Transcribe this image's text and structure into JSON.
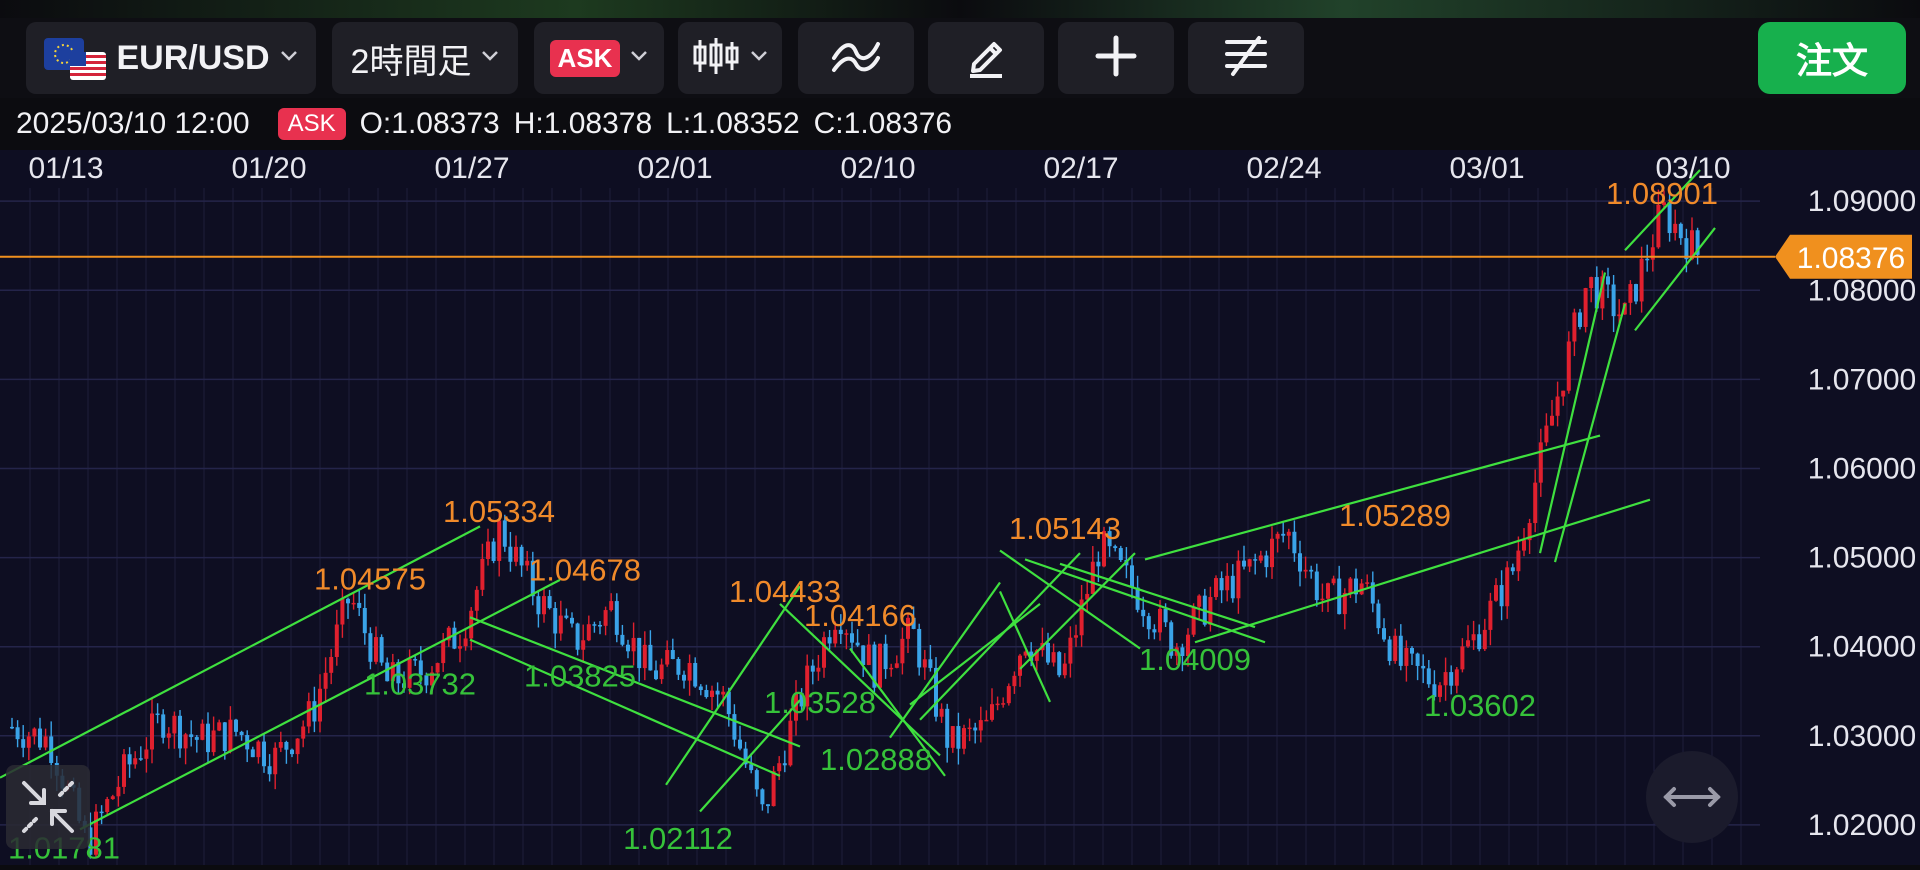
{
  "colors": {
    "ask": "#e8314f",
    "order": "#17b04d",
    "bull": "#e0202e",
    "bear": "#3aa3e8",
    "trendline": "#3fe03f",
    "high_label": "#f08a2a",
    "low_label": "#36c23a",
    "price_line": "#f0901e"
  },
  "toolbar": {
    "symbol": "EUR/USD",
    "timeframe": "2時間足",
    "price_side": "ASK",
    "order_label": "注文",
    "icons": [
      "flag-eu-us-icon",
      "chevron-down-icon",
      "candlestick-icon",
      "indicator-icon",
      "pen-icon",
      "crosshair-icon",
      "drawing-tools-icon"
    ]
  },
  "info": {
    "datetime": "2025/03/10 12:00",
    "side": "ASK",
    "open": "O:1.08373",
    "high": "H:1.08378",
    "low": "L:1.08352",
    "close": "C:1.08376"
  },
  "current_price": "1.08376",
  "chart_data": {
    "type": "candlestick",
    "x_ticks": [
      "01/13",
      "01/20",
      "01/27",
      "02/01",
      "02/10",
      "02/17",
      "02/24",
      "03/01",
      "03/10"
    ],
    "y_ticks": [
      "1.09000",
      "1.08000",
      "1.07000",
      "1.06000",
      "1.05000",
      "1.04000",
      "1.03000",
      "1.02000"
    ],
    "ylim": [
      1.0155,
      1.0935
    ],
    "last": 1.08376,
    "path": [
      1.031,
      1.0295,
      1.0178,
      1.026,
      1.032,
      1.0295,
      1.0305,
      1.0275,
      1.0325,
      1.0457,
      1.036,
      1.0373,
      1.042,
      1.0533,
      1.0455,
      1.0405,
      1.0445,
      1.037,
      1.0383,
      1.034,
      1.0211,
      1.034,
      1.0443,
      1.0375,
      1.0417,
      1.0289,
      1.031,
      1.041,
      1.0365,
      1.0514,
      1.046,
      1.0401,
      1.0455,
      1.0487,
      1.0529,
      1.045,
      1.0472,
      1.038,
      1.036,
      1.041,
      1.0485,
      1.065,
      1.081,
      1.077,
      1.089,
      1.0838
    ],
    "annotations": [
      {
        "label": "1.01781",
        "kind": "low"
      },
      {
        "label": "1.04575",
        "kind": "high"
      },
      {
        "label": "1.03732",
        "kind": "low"
      },
      {
        "label": "1.05334",
        "kind": "high"
      },
      {
        "label": "1.04678",
        "kind": "high"
      },
      {
        "label": "1.03825",
        "kind": "low"
      },
      {
        "label": "1.02112",
        "kind": "low"
      },
      {
        "label": "1.04433",
        "kind": "high"
      },
      {
        "label": "1.04166",
        "kind": "high"
      },
      {
        "label": "1.03528",
        "kind": "low"
      },
      {
        "label": "1.02888",
        "kind": "low"
      },
      {
        "label": "1.05143",
        "kind": "high"
      },
      {
        "label": "1.04009",
        "kind": "low"
      },
      {
        "label": "1.05289",
        "kind": "high"
      },
      {
        "label": "1.03602",
        "kind": "low"
      },
      {
        "label": "1.08901",
        "kind": "high"
      }
    ]
  }
}
